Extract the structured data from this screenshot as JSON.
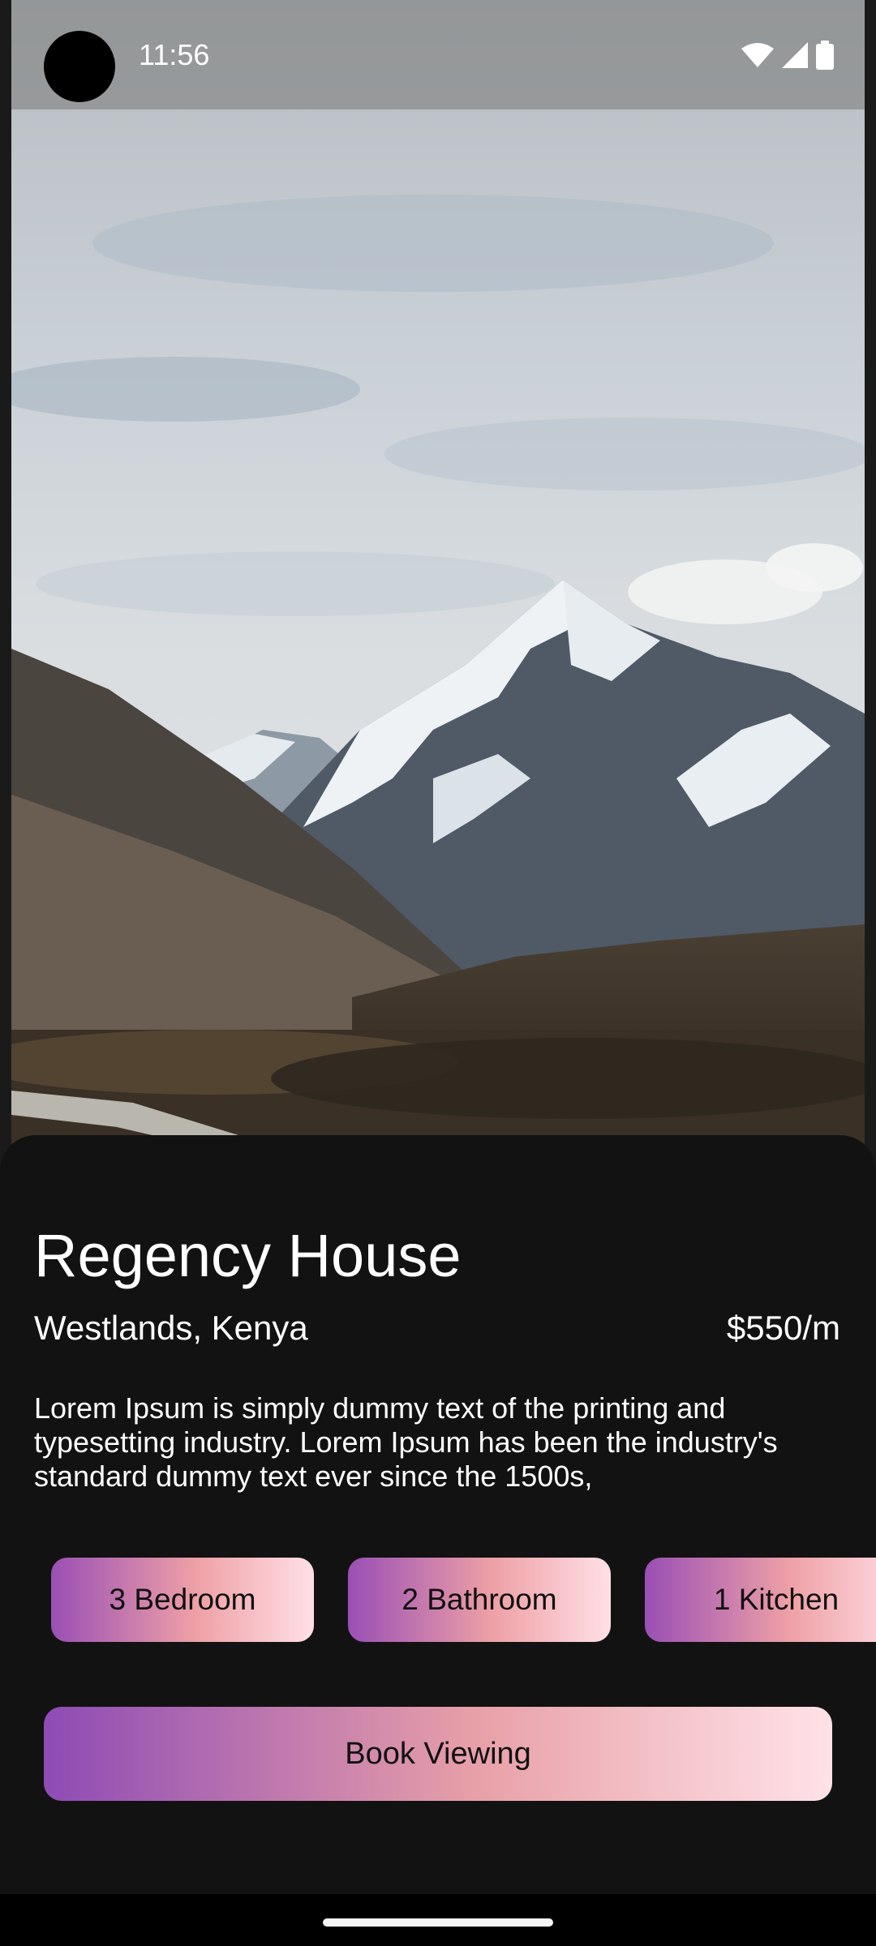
{
  "status_bar": {
    "time": "11:56",
    "icons": [
      "wifi-icon",
      "signal-icon",
      "battery-icon"
    ]
  },
  "hero": {
    "image_description": "Snow-capped mountain under cloudy sky"
  },
  "property": {
    "title": "Regency House",
    "location": "Westlands, Kenya",
    "price": "$550/m",
    "description": "Lorem Ipsum is simply dummy text of the printing and typesetting industry. Lorem Ipsum has been the industry's standard dummy text ever since the 1500s,"
  },
  "features": [
    {
      "label": "3 Bedroom"
    },
    {
      "label": "2 Bathroom"
    },
    {
      "label": "1 Kitchen"
    }
  ],
  "actions": {
    "book_label": "Book Viewing"
  },
  "colors": {
    "background": "#121212",
    "gradient_start": "#9a4fb5",
    "gradient_mid": "#eea0a6",
    "gradient_end": "#ffe0e6",
    "text": "#ffffff"
  }
}
